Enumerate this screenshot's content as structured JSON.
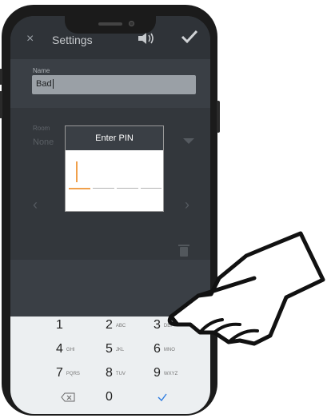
{
  "header": {
    "close_label": "×",
    "title": "Settings"
  },
  "name_field": {
    "label": "Name",
    "value": "Bad"
  },
  "room_field": {
    "label": "Room",
    "value": "None"
  },
  "pin_dialog": {
    "title": "Enter PIN"
  },
  "keypad": {
    "rows": [
      [
        {
          "num": "1",
          "letters": ""
        },
        {
          "num": "2",
          "letters": "ABC"
        },
        {
          "num": "3",
          "letters": "DEF"
        }
      ],
      [
        {
          "num": "4",
          "letters": "GHI"
        },
        {
          "num": "5",
          "letters": "JKL"
        },
        {
          "num": "6",
          "letters": "MNO"
        }
      ],
      [
        {
          "num": "7",
          "letters": "PQRS"
        },
        {
          "num": "8",
          "letters": "TUV"
        },
        {
          "num": "9",
          "letters": "WXYZ"
        }
      ],
      [
        {
          "num": "",
          "letters": ""
        },
        {
          "num": "0",
          "letters": ""
        },
        {
          "num": "",
          "letters": ""
        }
      ]
    ]
  },
  "colors": {
    "accent": "#f0a04b",
    "done_blue": "#2f7de1"
  }
}
